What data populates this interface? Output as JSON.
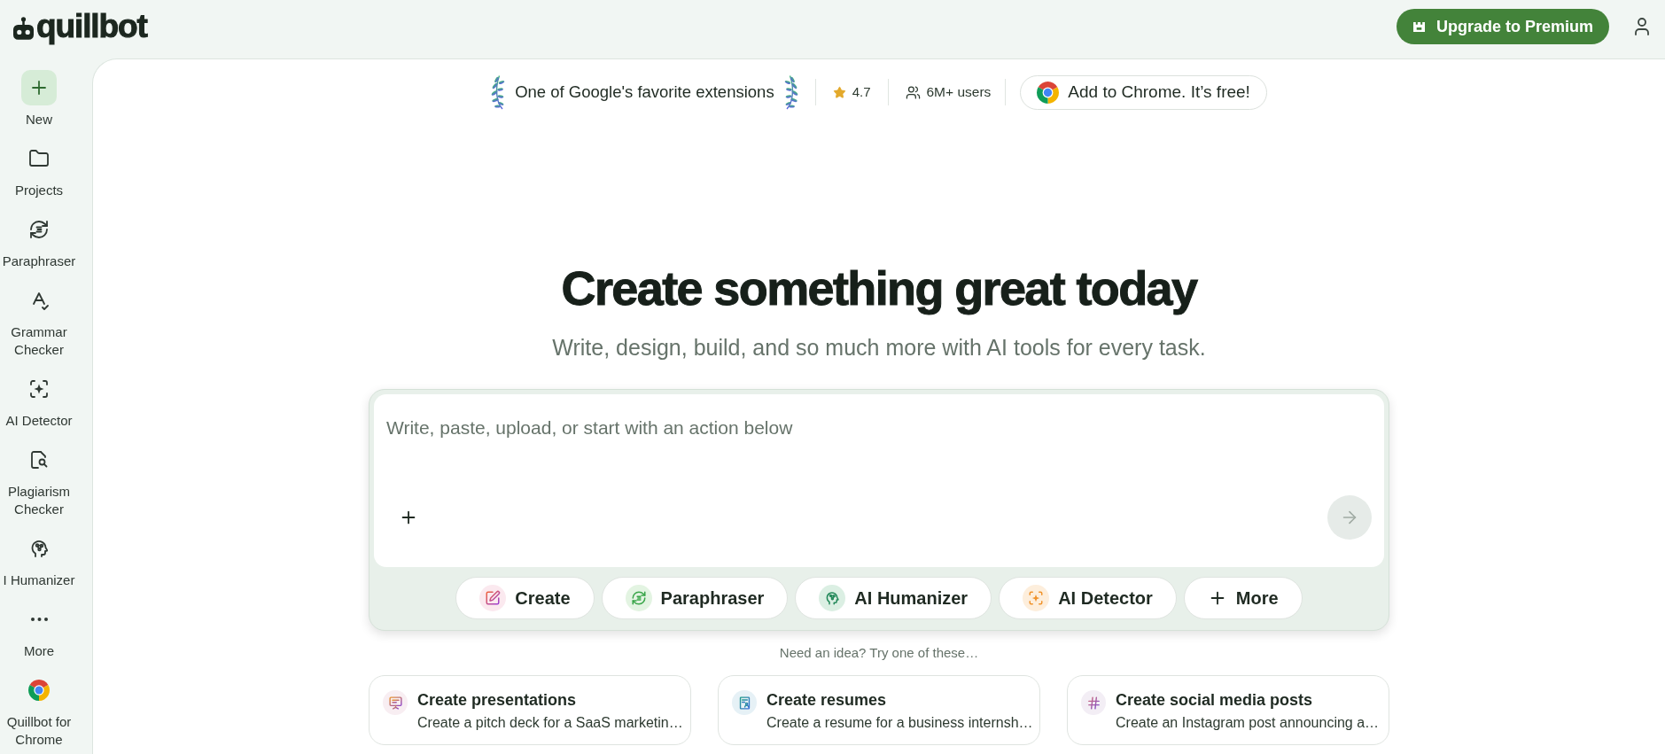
{
  "header": {
    "logo": "quillbot",
    "upgrade_button": "Upgrade to Premium"
  },
  "sidebar": {
    "items": [
      {
        "label": "New",
        "kind": "action"
      },
      {
        "label": "Projects",
        "kind": "nav"
      },
      {
        "label": "Paraphraser",
        "kind": "nav"
      },
      {
        "label": "Grammar Checker",
        "kind": "nav"
      },
      {
        "label": "AI Detector",
        "kind": "nav"
      },
      {
        "label": "Plagiarism Checker",
        "kind": "nav"
      },
      {
        "label": "I Humanizer",
        "kind": "nav"
      },
      {
        "label": "More",
        "kind": "nav"
      },
      {
        "label": "Quillbot for Chrome",
        "kind": "nav"
      }
    ]
  },
  "banner": {
    "award": "One of Google's favorite extensions",
    "rating": "4.7",
    "users": "6M+ users",
    "chrome_button": "Add to Chrome. It’s free!"
  },
  "hero": {
    "title": "Create something great today",
    "subtitle": "Write, design, build, and so much more with AI tools for every task."
  },
  "composer": {
    "placeholder": "Write, paste, upload, or start with an action below",
    "actions": [
      {
        "label": "Create"
      },
      {
        "label": "Paraphraser"
      },
      {
        "label": "AI Humanizer"
      },
      {
        "label": "AI Detector"
      },
      {
        "label": "More"
      }
    ]
  },
  "suggestions": {
    "heading": "Need an idea? Try one of these…",
    "cards": [
      {
        "title": "Create presentations",
        "description": "Create a pitch deck for a SaaS marketin…"
      },
      {
        "title": "Create resumes",
        "description": "Create a resume for a business internsh…"
      },
      {
        "title": "Create social media posts",
        "description": "Create an Instagram post announcing a…"
      }
    ]
  }
}
